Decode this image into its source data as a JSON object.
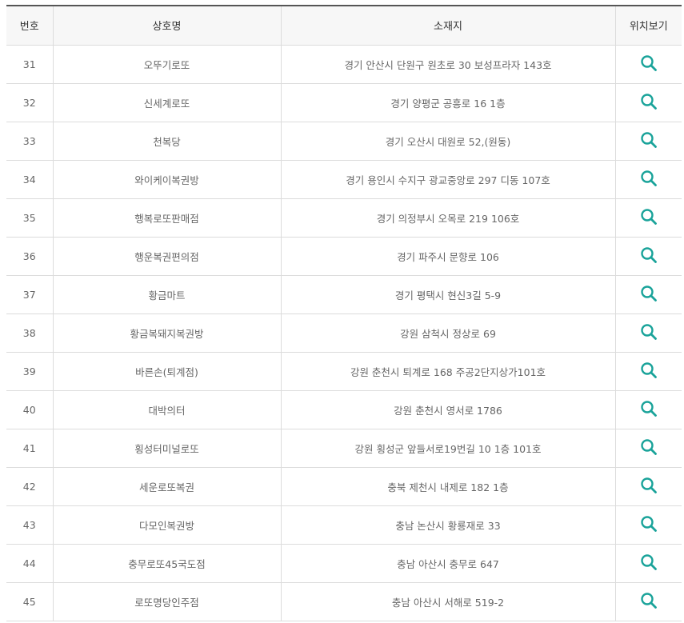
{
  "table": {
    "headers": {
      "number": "번호",
      "name": "상호명",
      "address": "소재지",
      "location": "위치보기"
    },
    "rows": [
      {
        "no": "31",
        "name": "오뚜기로또",
        "address": "경기 안산시 단원구 원초로 30 보성프라자 143호"
      },
      {
        "no": "32",
        "name": "신세계로또",
        "address": "경기 양평군 공흥로 16 1층"
      },
      {
        "no": "33",
        "name": "천복당",
        "address": "경기 오산시 대원로 52,(원동)"
      },
      {
        "no": "34",
        "name": "와이케이복권방",
        "address": "경기 용인시 수지구 광교중앙로 297 디동 107호"
      },
      {
        "no": "35",
        "name": "행복로또판매점",
        "address": "경기 의정부시 오목로 219 106호"
      },
      {
        "no": "36",
        "name": "행운복권편의점",
        "address": "경기 파주시 문향로 106"
      },
      {
        "no": "37",
        "name": "황금마트",
        "address": "경기 평택시 현신3길 5-9"
      },
      {
        "no": "38",
        "name": "황금복돼지복권방",
        "address": "강원 삼척시 정상로 69"
      },
      {
        "no": "39",
        "name": "바른손(퇴계점)",
        "address": "강원 춘천시 퇴계로 168 주공2단지상가101호"
      },
      {
        "no": "40",
        "name": "대박의터",
        "address": "강원 춘천시 영서로 1786"
      },
      {
        "no": "41",
        "name": "횡성터미널로또",
        "address": "강원 횡성군 앞들서로19번길 10 1층 101호"
      },
      {
        "no": "42",
        "name": "세운로또복권",
        "address": "충북 제천시 내제로 182 1층"
      },
      {
        "no": "43",
        "name": "다모인복권방",
        "address": "충남 논산시 황룡재로 33"
      },
      {
        "no": "44",
        "name": "충무로또45국도점",
        "address": "충남 아산시 충무로 647"
      },
      {
        "no": "45",
        "name": "로또명당인주점",
        "address": "충남 아산시 서해로 519-2"
      }
    ]
  },
  "icon": {
    "name": "search-icon",
    "color": "#1aa39a"
  },
  "colors": {
    "header_border": "#555555",
    "header_bg": "#f7f7f7",
    "grid": "#dcdcdc",
    "text": "#666666"
  }
}
